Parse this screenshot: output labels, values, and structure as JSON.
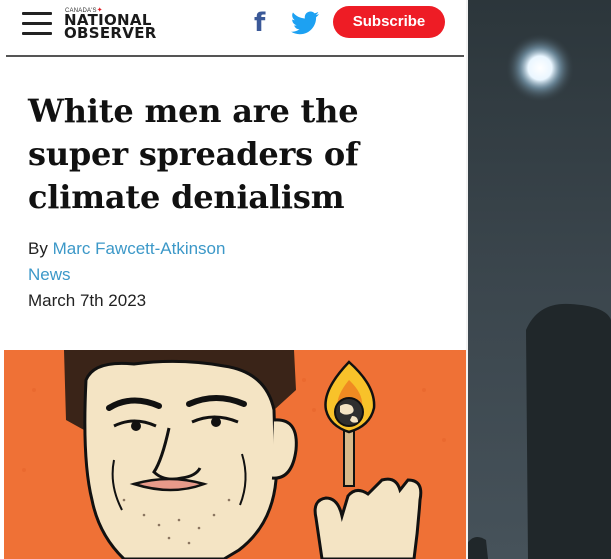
{
  "header": {
    "logo_top": "CANADA'S",
    "logo_line1": "NATIONAL",
    "logo_line2": "OBSERVER",
    "subscribe_label": "Subscribe",
    "icons": {
      "menu": "hamburger-menu-icon",
      "facebook": "facebook-icon",
      "twitter": "twitter-icon"
    }
  },
  "article": {
    "headline": "White men are the super spreaders of climate denialism",
    "byline_prefix": "By",
    "author": "Marc Fawcett-Atkinson",
    "section": "News",
    "date": "March 7th 2023"
  },
  "colors": {
    "brand_red": "#ee1c25",
    "link_blue": "#3c98c8",
    "facebook_blue": "#3b5998",
    "twitter_blue": "#1da1f2",
    "illustration_orange": "#ef7136",
    "night_sky": "#3b464d"
  }
}
